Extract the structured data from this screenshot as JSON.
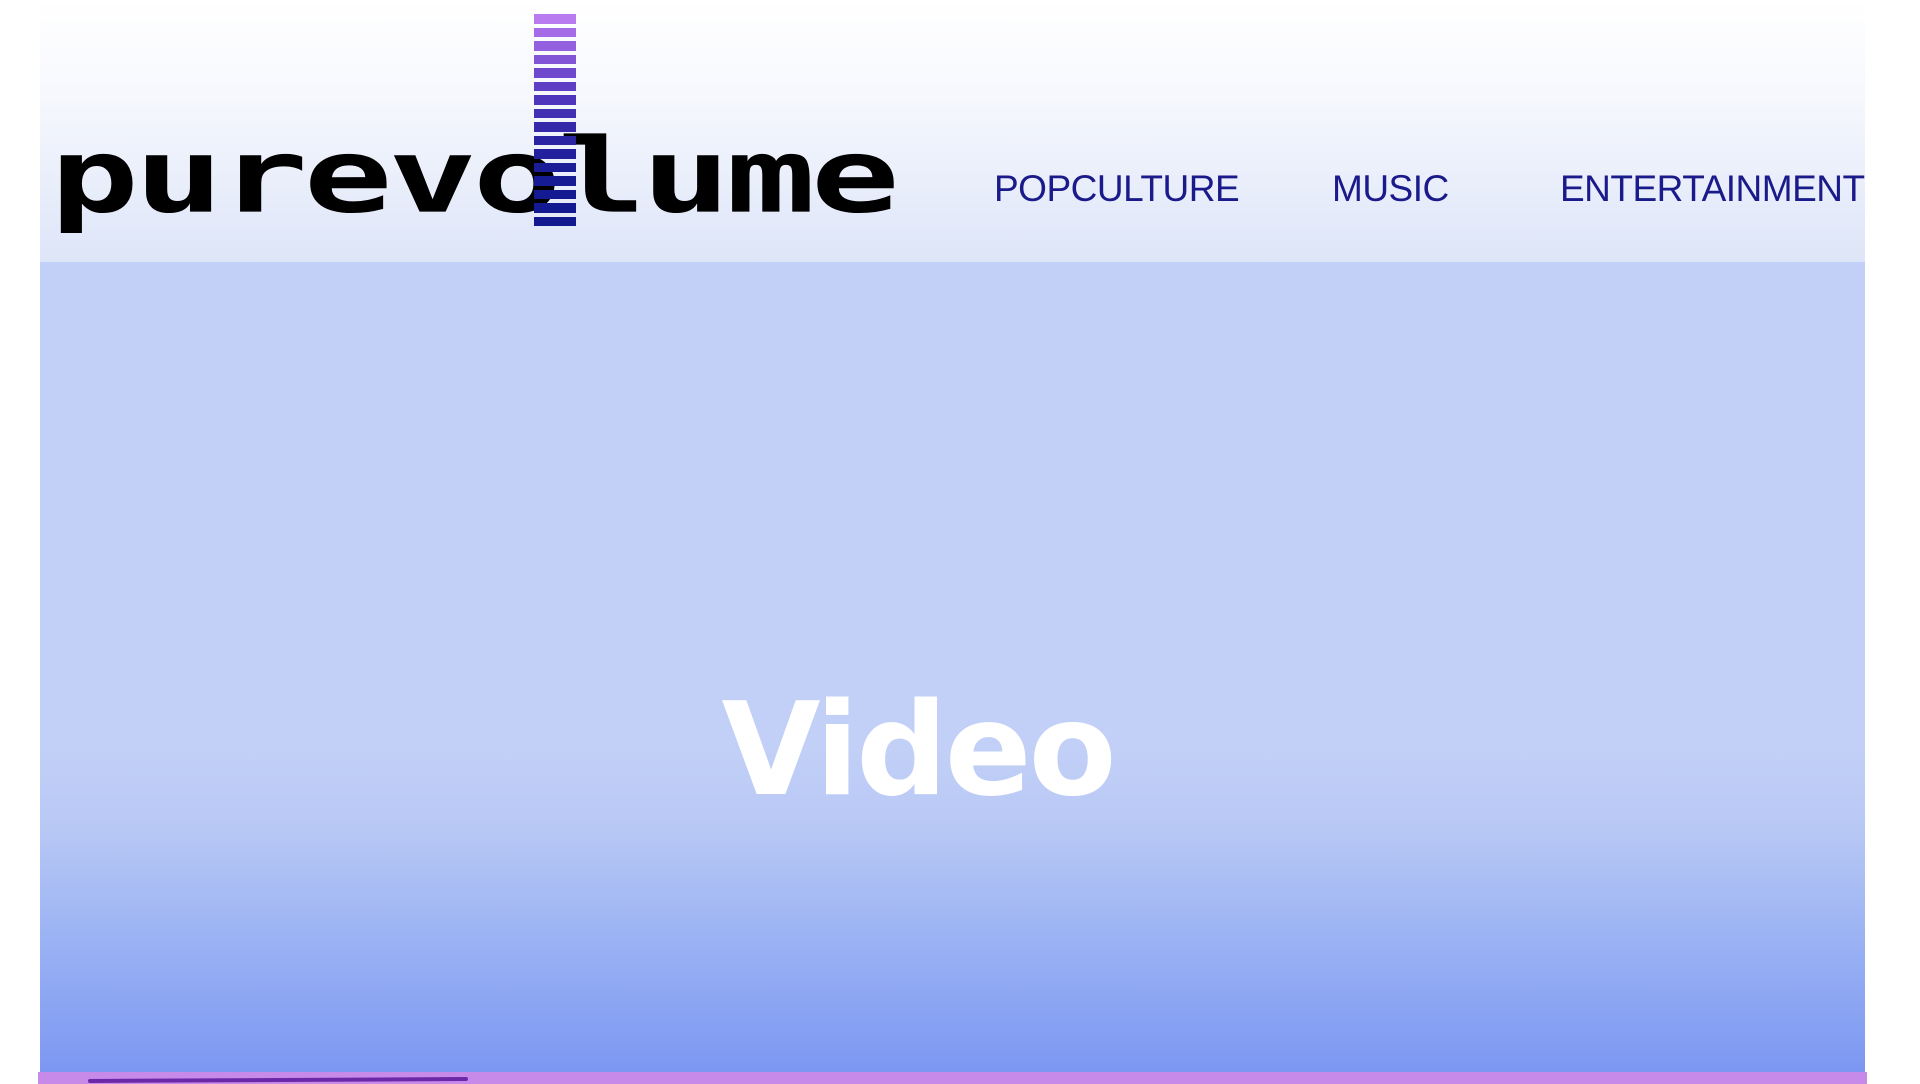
{
  "brand": {
    "logo_text": "purevolume",
    "meter_colors": [
      "#b97cf0",
      "#a66ce8",
      "#9360df",
      "#8155d6",
      "#6f49cd",
      "#5f3fc4",
      "#4f35bb",
      "#4130b2",
      "#3529aa",
      "#2a24a2",
      "#22209c",
      "#1b1d97",
      "#161b93",
      "#141a91",
      "#131990",
      "#13198f"
    ]
  },
  "nav": {
    "items": [
      {
        "label": "POPCULTURE"
      },
      {
        "label": "MUSIC"
      },
      {
        "label": "ENTERTAINMENT"
      }
    ]
  },
  "main": {
    "video_label": "Video"
  },
  "colors": {
    "nav_text": "#1a1a8a",
    "video_bg": "#c2d0f7",
    "bottom_bar": "#c78ae8"
  }
}
